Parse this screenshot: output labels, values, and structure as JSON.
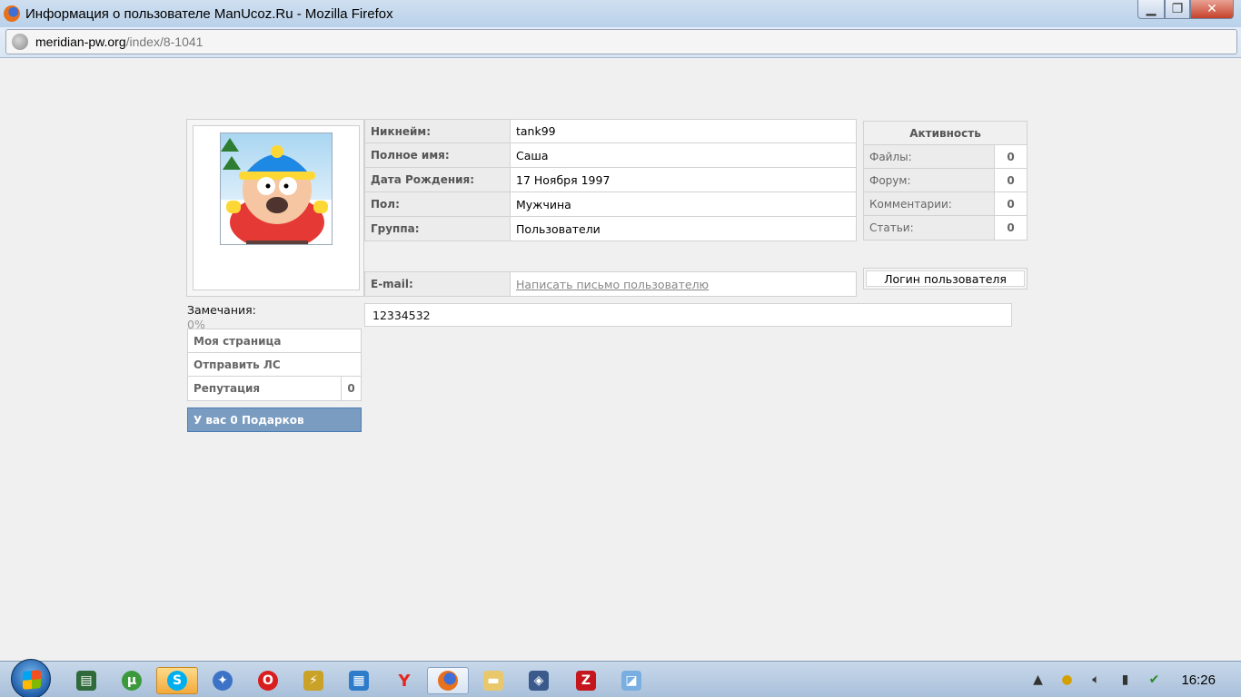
{
  "window": {
    "title": "Информация о пользователе ManUcoz.Ru - Mozilla Firefox",
    "url_domain": "meridian-pw.org",
    "url_path": "/index/8-1041"
  },
  "profile": {
    "fields": [
      {
        "label": "Никнейм:",
        "value": "tank99"
      },
      {
        "label": "Полное имя:",
        "value": "Саша"
      },
      {
        "label": "Дата Рождения:",
        "value": "17 Ноября 1997"
      },
      {
        "label": "Пол:",
        "value": "Мужчина"
      },
      {
        "label": "Группа:",
        "value": "Пользователи"
      }
    ],
    "email_label": "E-mail:",
    "email_link": "Написать письмо пользователю",
    "remarks_label": "Замечания:",
    "remarks_value": "0%",
    "extra_field": "12334532"
  },
  "activity": {
    "title": "Активность",
    "rows": [
      {
        "label": "Файлы:",
        "value": "0"
      },
      {
        "label": "Форум:",
        "value": "0"
      },
      {
        "label": "Комментарии:",
        "value": "0"
      },
      {
        "label": "Статьи:",
        "value": "0"
      }
    ],
    "login_button": "Логин пользователя"
  },
  "menu": {
    "my_page": "Моя страница",
    "send_pm": "Отправить ЛС",
    "reputation_label": "Репутация",
    "reputation_value": "0",
    "gifts": "У вас 0 Подарков"
  },
  "taskbar": {
    "time": "16:26",
    "icons": [
      "task-manager-icon",
      "utorrent-icon",
      "skype-icon",
      "qip-icon",
      "opera-icon",
      "winamp-icon",
      "photo-icon",
      "yandex-icon",
      "firefox-icon",
      "explorer-icon",
      "virtualbox-icon",
      "filezilla-icon",
      "folder-icon"
    ]
  }
}
